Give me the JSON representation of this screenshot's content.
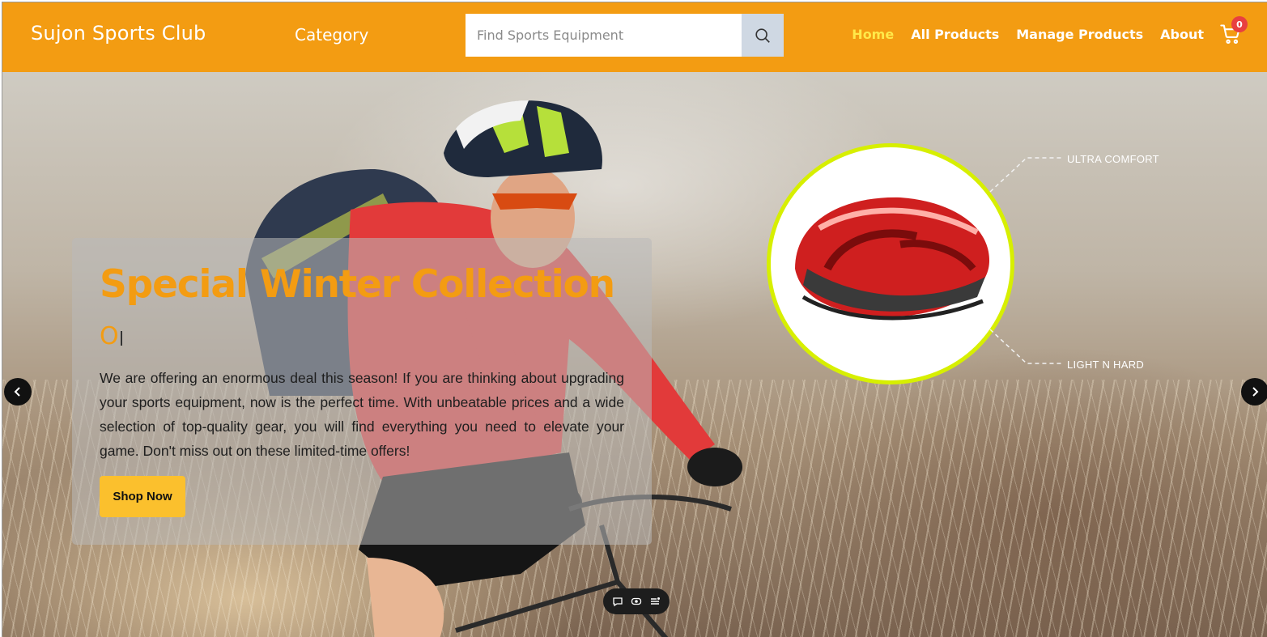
{
  "navbar": {
    "brand": "Sujon Sports Club",
    "category_label": "Category",
    "search_placeholder": "Find Sports Equipment",
    "links": [
      {
        "label": "Home",
        "active": true
      },
      {
        "label": "All Products",
        "active": false
      },
      {
        "label": "Manage Products",
        "active": false
      },
      {
        "label": "About",
        "active": false
      }
    ],
    "cart_count": "0",
    "bar_color": "#f39c12",
    "active_link_color": "#ffe94a"
  },
  "hero": {
    "title": "Special Winter Collection",
    "typed_text": "O",
    "description": "We are offering an enormous deal this season! If you are thinking about upgrading your sports equipment, now is the perfect time. With unbeatable prices and a wide selection of top-quality gear, you will find everything you need to elevate your game. Don't miss out on these limited-time offers!",
    "shop_button": "Shop Now",
    "accent_color": "#f39c12",
    "button_color": "#fbc02d",
    "callouts": [
      "ULTRA COMFORT",
      "LIGHT N HARD"
    ]
  },
  "carousel": {
    "prev_icon": "chevron-left-icon",
    "next_icon": "chevron-right-icon"
  },
  "mini_toolbar": {
    "icons": [
      "comment-icon",
      "view-icon",
      "menu-list-icon"
    ]
  }
}
